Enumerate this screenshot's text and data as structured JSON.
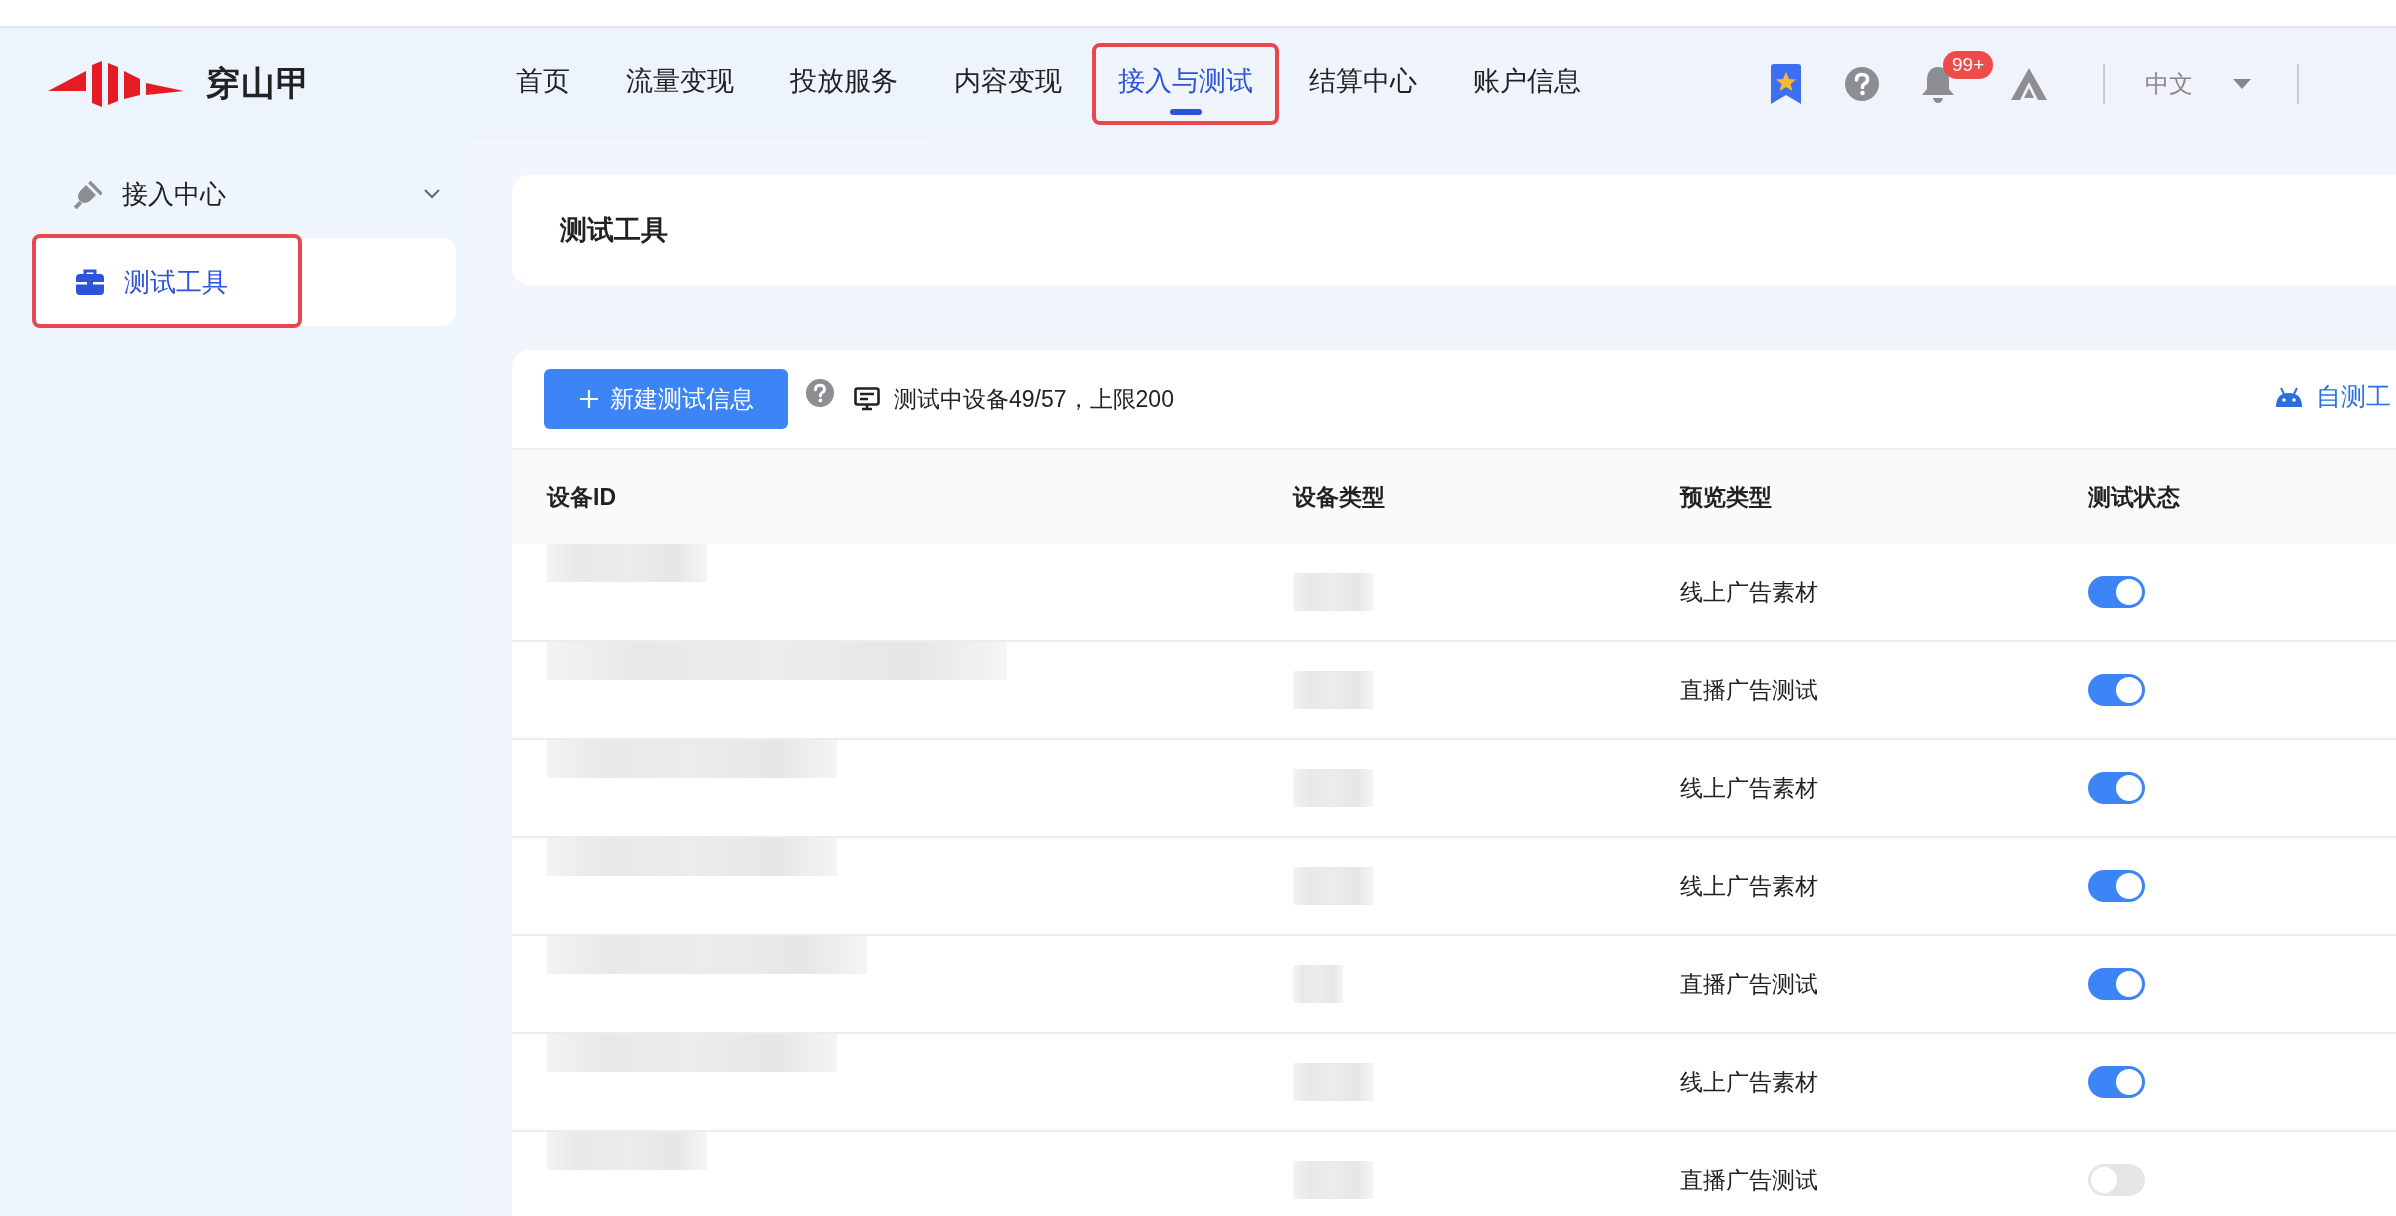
{
  "header": {
    "logo_text": "穿山甲",
    "nav": [
      {
        "label": "首页",
        "selected": false,
        "annotated": false
      },
      {
        "label": "流量变现",
        "selected": false,
        "annotated": false
      },
      {
        "label": "投放服务",
        "selected": false,
        "annotated": false
      },
      {
        "label": "内容变现",
        "selected": false,
        "annotated": false
      },
      {
        "label": "接入与测试",
        "selected": true,
        "annotated": true
      },
      {
        "label": "结算中心",
        "selected": false,
        "annotated": false
      },
      {
        "label": "账户信息",
        "selected": false,
        "annotated": false
      }
    ],
    "notification_badge": "99+",
    "language": "中文"
  },
  "sidebar": {
    "items": [
      {
        "label": "接入中心",
        "expanded": true,
        "children": [
          {
            "label": "测试工具",
            "selected": true,
            "annotated": true
          }
        ]
      }
    ]
  },
  "page_title": "测试工具",
  "toolbar": {
    "new_button": "新建测试信息",
    "device_count": "测试中设备49/57，上限200",
    "self_test_link": "自测工"
  },
  "table": {
    "columns": [
      "设备ID",
      "设备类型",
      "预览类型",
      "测试状态"
    ],
    "rows": [
      {
        "preview_type": "线上广告素材",
        "testing": true
      },
      {
        "preview_type": "直播广告测试",
        "testing": true
      },
      {
        "preview_type": "线上广告素材",
        "testing": true
      },
      {
        "preview_type": "线上广告素材",
        "testing": true
      },
      {
        "preview_type": "直播广告测试",
        "testing": true
      },
      {
        "preview_type": "线上广告素材",
        "testing": true
      },
      {
        "preview_type": "直播广告测试",
        "testing": false
      }
    ]
  }
}
